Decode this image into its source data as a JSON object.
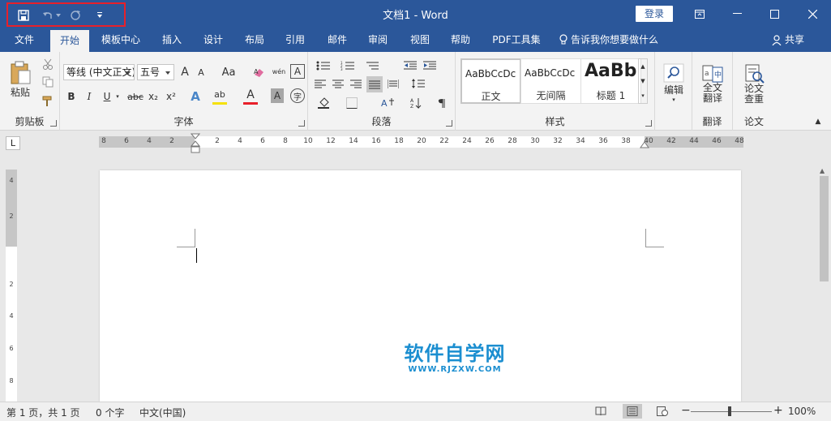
{
  "window": {
    "title": "文档1  -  Word",
    "login_label": "登录"
  },
  "tabs": [
    {
      "label": "文件"
    },
    {
      "label": "开始"
    },
    {
      "label": "模板中心"
    },
    {
      "label": "插入"
    },
    {
      "label": "设计"
    },
    {
      "label": "布局"
    },
    {
      "label": "引用"
    },
    {
      "label": "邮件"
    },
    {
      "label": "审阅"
    },
    {
      "label": "视图"
    },
    {
      "label": "帮助"
    },
    {
      "label": "PDF工具集"
    }
  ],
  "tell_me": "告诉我你想要做什么",
  "share": "共享",
  "ribbon": {
    "clipboard": {
      "label": "剪贴板",
      "paste": "粘贴"
    },
    "font": {
      "label": "字体",
      "font_name": "等线 (中文正文)",
      "font_size": "五号",
      "grow": "A",
      "shrink": "A",
      "case": "Aa",
      "pinyin": "wén",
      "bold": "B",
      "italic": "I",
      "underline": "U",
      "strike": "abc",
      "sub": "x₂",
      "sup": "x²",
      "effect": "A",
      "highlight": "ab",
      "color": "A",
      "shading": "A",
      "border_char": "A",
      "enclose": "字"
    },
    "paragraph": {
      "label": "段落"
    },
    "styles": {
      "label": "样式",
      "items": [
        {
          "preview": "AaBbCcDc",
          "name": "正文"
        },
        {
          "preview": "AaBbCcDc",
          "name": "无间隔"
        },
        {
          "preview": "AaBb",
          "name": "标题 1"
        }
      ]
    },
    "edit": {
      "label": "编辑"
    },
    "translate": {
      "button": "全文\n翻译",
      "label": "翻译"
    },
    "thesis": {
      "button": "论文\n查重",
      "label": "论文"
    }
  },
  "ruler": {
    "left_ticks": [
      "8",
      "6",
      "4",
      "2"
    ],
    "right_ticks": [
      "2",
      "4",
      "6",
      "8",
      "10",
      "12",
      "14",
      "16",
      "18",
      "20",
      "22",
      "24",
      "26",
      "28",
      "30",
      "32",
      "34",
      "36",
      "38",
      "40",
      "42",
      "44",
      "46",
      "48"
    ],
    "v_ticks": [
      "4",
      "2",
      "2",
      "4",
      "6",
      "8"
    ],
    "corner": "L"
  },
  "watermark": {
    "main": "软件自学网",
    "sub": "WWW.RJZXW.COM"
  },
  "status": {
    "pages": "第 1 页，共 1 页",
    "words": "0 个字",
    "language": "中文(中国)",
    "zoom": "100%",
    "zoom_minus": "−",
    "zoom_plus": "+"
  },
  "colors": {
    "brand": "#2b579a",
    "highlight_marker": "#e8202a",
    "watermark": "#1b8ed0"
  }
}
